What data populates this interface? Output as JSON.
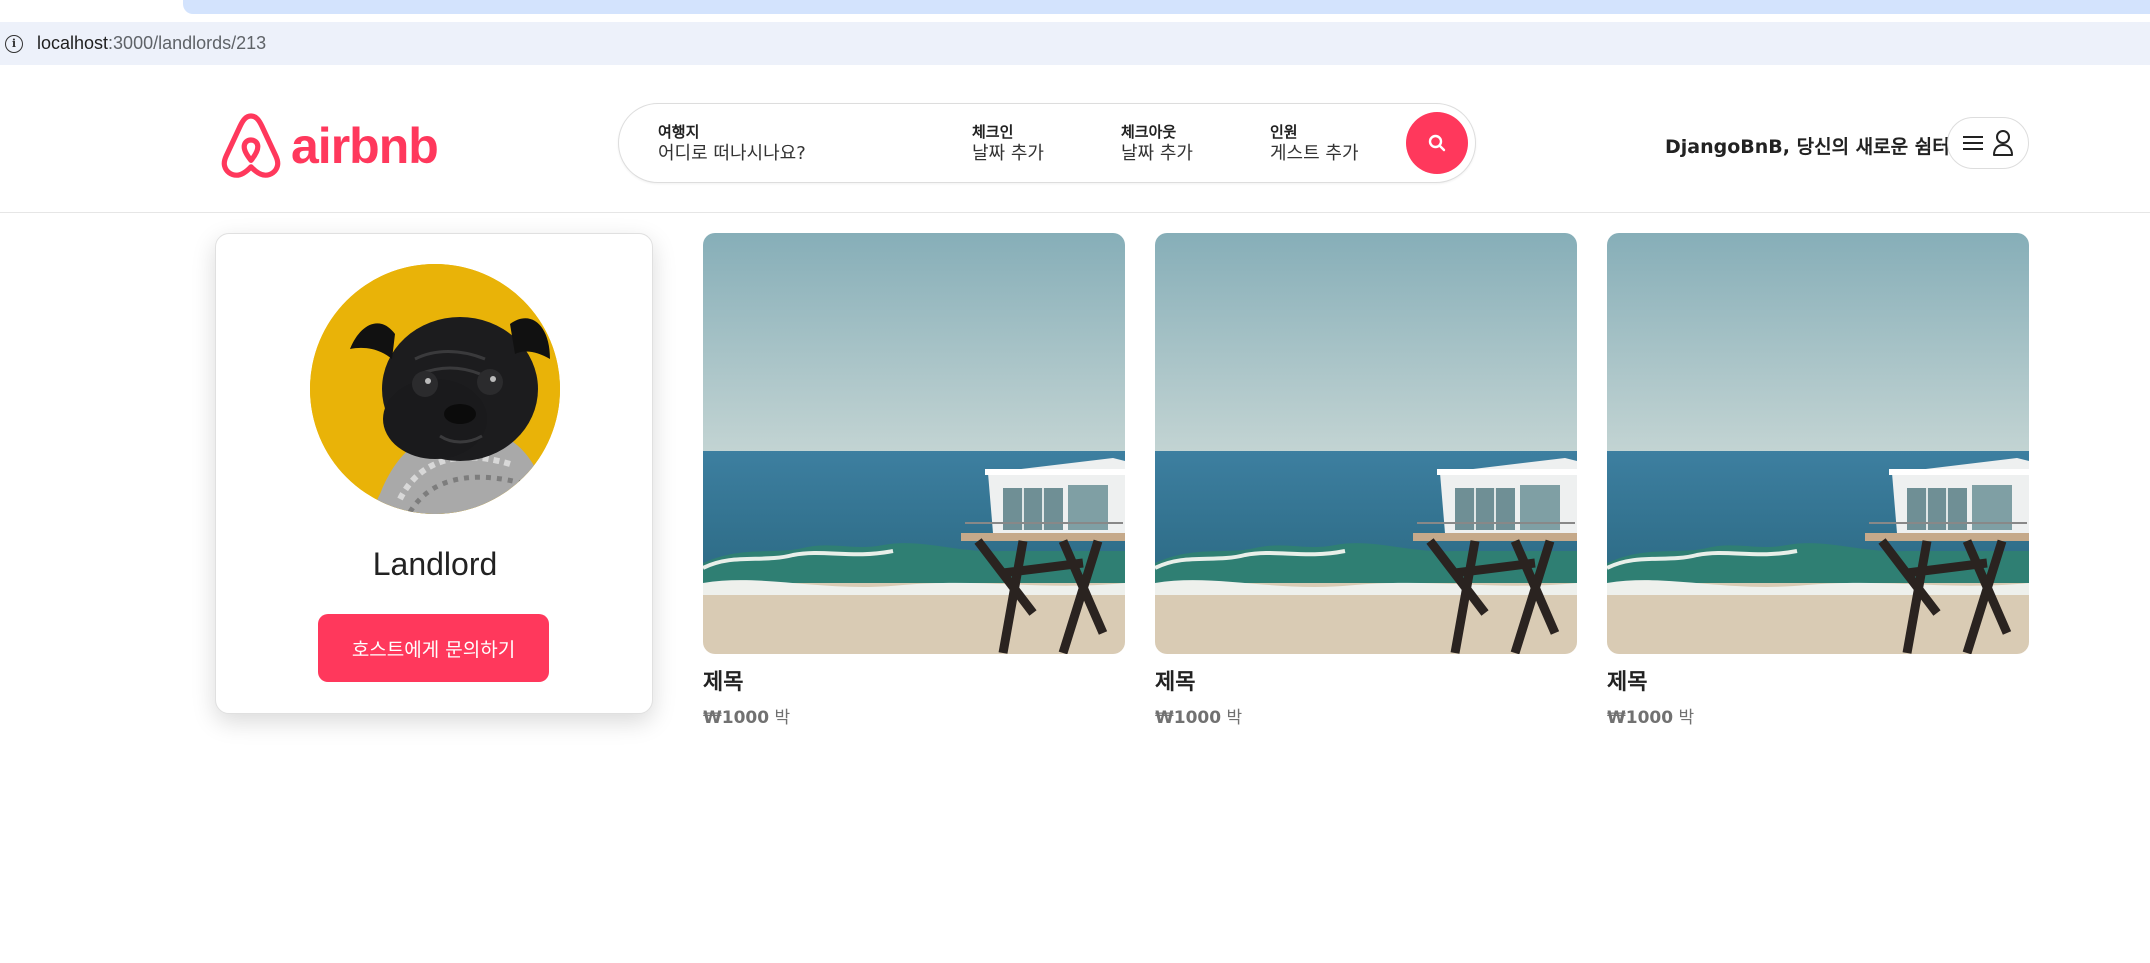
{
  "browser": {
    "url_host": "localhost",
    "url_path": ":3000/landlords/213"
  },
  "header": {
    "logo_text": "airbnb",
    "tagline": "DjangoBnB, 당신의 새로운 쉼터",
    "search": {
      "where_label": "여행지",
      "where_value": "어디로 떠나시나요?",
      "checkin_label": "체크인",
      "checkin_value": "날짜 추가",
      "checkout_label": "체크아웃",
      "checkout_value": "날짜 추가",
      "guests_label": "인원",
      "guests_value": "게스트 추가"
    }
  },
  "profile": {
    "name": "Landlord",
    "contact_button": "호스트에게 문의하기"
  },
  "listings": [
    {
      "title": "제목",
      "price": "₩1000",
      "unit": "박"
    },
    {
      "title": "제목",
      "price": "₩1000",
      "unit": "박"
    },
    {
      "title": "제목",
      "price": "₩1000",
      "unit": "박"
    }
  ],
  "colors": {
    "brand": "#ff385c",
    "avatar_bg": "#e9b308"
  }
}
